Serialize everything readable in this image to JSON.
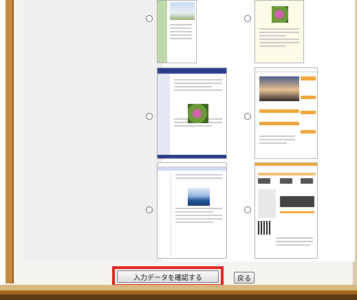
{
  "form": {
    "confirm_button_label": "入力データを確認する",
    "back_button_label": "戻る"
  },
  "templates": [
    {
      "id": "template-1",
      "name": "template-option-1"
    },
    {
      "id": "template-2",
      "name": "template-option-2"
    },
    {
      "id": "template-3",
      "name": "template-option-3"
    },
    {
      "id": "template-4",
      "name": "template-option-4"
    },
    {
      "id": "template-5",
      "name": "template-option-5"
    },
    {
      "id": "template-6",
      "name": "template-option-6"
    }
  ],
  "colors": {
    "highlight": "#e0201f",
    "frame_brown": "#a0691f",
    "header_navy": "#2c3c8a",
    "accent_orange": "#f0a53a"
  }
}
